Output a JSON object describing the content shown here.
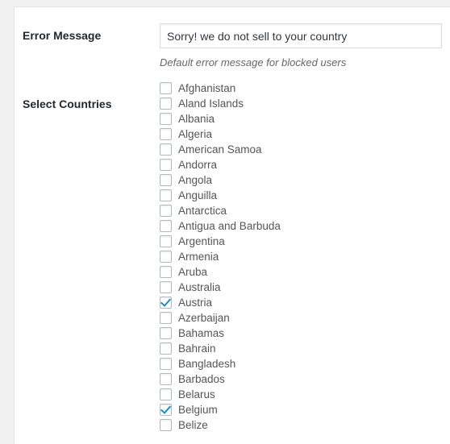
{
  "panel": {
    "background_color": "#ffffff",
    "gutter_color": "#f1f1f1",
    "border_color": "#e5e5e5"
  },
  "error_message_field": {
    "label": "Error Message",
    "value": "Sorry! we do not sell to your country",
    "placeholder": "",
    "description": "Default error message for blocked users"
  },
  "select_countries_field": {
    "label": "Select Countries",
    "checked_color": "#1e8cbe",
    "checkbox_border_color": "#b4b9be",
    "countries": [
      {
        "name": "Afghanistan",
        "checked": false
      },
      {
        "name": "Aland Islands",
        "checked": false
      },
      {
        "name": "Albania",
        "checked": false
      },
      {
        "name": "Algeria",
        "checked": false
      },
      {
        "name": "American Samoa",
        "checked": false
      },
      {
        "name": "Andorra",
        "checked": false
      },
      {
        "name": "Angola",
        "checked": false
      },
      {
        "name": "Anguilla",
        "checked": false
      },
      {
        "name": "Antarctica",
        "checked": false
      },
      {
        "name": "Antigua and Barbuda",
        "checked": false
      },
      {
        "name": "Argentina",
        "checked": false
      },
      {
        "name": "Armenia",
        "checked": false
      },
      {
        "name": "Aruba",
        "checked": false
      },
      {
        "name": "Australia",
        "checked": false
      },
      {
        "name": "Austria",
        "checked": true
      },
      {
        "name": "Azerbaijan",
        "checked": false
      },
      {
        "name": "Bahamas",
        "checked": false
      },
      {
        "name": "Bahrain",
        "checked": false
      },
      {
        "name": "Bangladesh",
        "checked": false
      },
      {
        "name": "Barbados",
        "checked": false
      },
      {
        "name": "Belarus",
        "checked": false
      },
      {
        "name": "Belgium",
        "checked": true
      },
      {
        "name": "Belize",
        "checked": false
      }
    ]
  }
}
